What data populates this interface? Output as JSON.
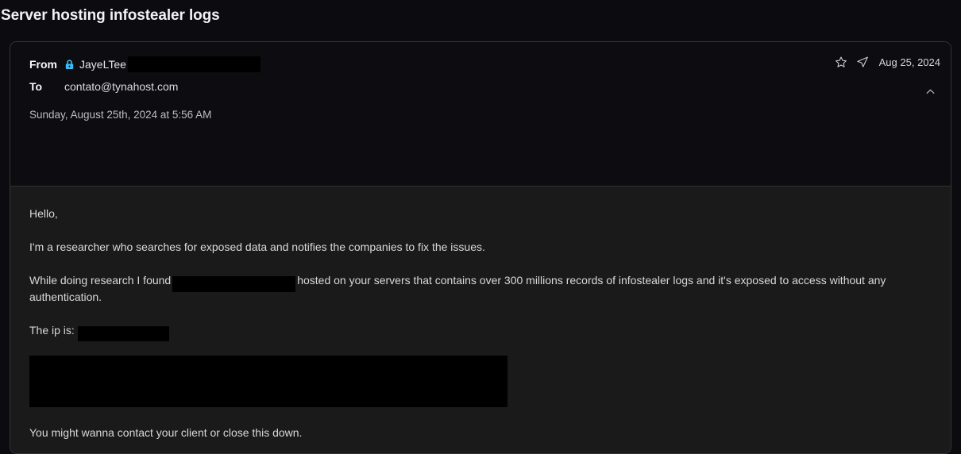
{
  "page": {
    "title": "Server hosting infostealer logs",
    "background_color": "#0b0b10",
    "body_background_color": "#1a1a1a",
    "accent_lock_color": "#38bdf8"
  },
  "message": {
    "from": {
      "label": "From",
      "lock_icon": "lock-icon",
      "sender_name": "JayeLTee",
      "redacted_address": ""
    },
    "to": {
      "label": "To",
      "address": "contato@tynahost.com"
    },
    "datetime": "Sunday, August 25th, 2024 at 5:56 AM",
    "date_short": "Aug 25, 2024",
    "meta_icons": [
      {
        "name": "star-icon",
        "title": "Star"
      },
      {
        "name": "send-icon",
        "title": "Send"
      }
    ],
    "collapse_icon": "chevron-up-icon"
  },
  "left_toolbar": {
    "buttons": [
      {
        "name": "mark-unread-button",
        "icon": "envelope-dot-icon",
        "title": "Mark as unread"
      },
      {
        "name": "delete-button",
        "icon": "trash-icon",
        "title": "Delete"
      },
      {
        "name": "move-to-folder-button",
        "icon": "archive-arrow-icon",
        "title": "Move to"
      },
      {
        "name": "tag-button",
        "icon": "tag-icon",
        "title": "Tag"
      },
      {
        "name": "filter-button",
        "icon": "filter-icon",
        "title": "Filter"
      },
      {
        "name": "more-options-button",
        "icon": "ellipsis-icon",
        "title": "More"
      }
    ]
  },
  "right_toolbar": {
    "buttons": [
      {
        "name": "reply-button",
        "icon": "reply-arrow-icon",
        "title": "Reply"
      },
      {
        "name": "reply-all-button",
        "icon": "reply-all-arrow-icon",
        "title": "Reply all"
      },
      {
        "name": "forward-button",
        "icon": "forward-arrow-icon",
        "title": "Forward"
      }
    ]
  },
  "body": {
    "greeting": "Hello,",
    "intro": "I'm a researcher who searches for exposed data and notifies the companies to fix the issues.",
    "finding_prefix": "While doing research I found",
    "finding_suffix": "hosted on your servers that contains over 300 millions records of infostealer logs and it's exposed to access without any authentication.",
    "ip_label": "The ip is:",
    "ip_redacted": "",
    "screenshot_redacted": "",
    "closing": "You might wanna contact your client or close this down."
  }
}
